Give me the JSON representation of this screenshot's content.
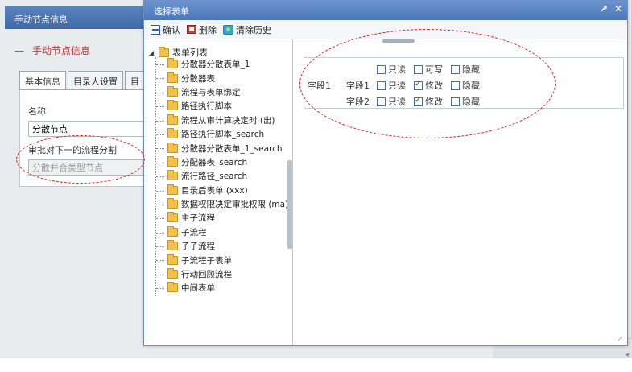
{
  "background": {
    "header_title": "手动节点信息",
    "page_title": "手动节点信息",
    "tabs": [
      "基本信息",
      "目录人设置",
      "目"
    ],
    "form": {
      "name_label": "名称",
      "name_value": "分散节点",
      "type_label": "审批对下一的流程分割",
      "type_value": "分散并合类型节点"
    }
  },
  "dialog": {
    "title": "选择表单",
    "controls": {
      "restore": "↗",
      "close": "✕"
    },
    "toolbar": {
      "confirm": "确认",
      "delete": "删除",
      "clear": "清除历史"
    },
    "tree": {
      "root": "表单列表",
      "items": [
        "分散器分散表单_1",
        "分散器表",
        "流程与表单绑定",
        "路径执行脚本",
        "流程从审计算决定时 (出)",
        "路径执行脚本_search",
        "分散器分散表单_1_search",
        "分配器表_search",
        "流行路径_search",
        "目录后表单 (xxx)",
        "数据权限决定审批权限 (ma)",
        "主子流程",
        "子流程",
        "子子流程",
        "子流程子表单",
        "行动回顾流程",
        "中间表单"
      ]
    },
    "fields": {
      "field_label": "字段1",
      "rows": [
        {
          "label": "",
          "options": [
            {
              "text": "只读",
              "checked": false
            },
            {
              "text": "可写",
              "checked": false
            },
            {
              "text": "隐藏",
              "checked": false
            }
          ]
        },
        {
          "label": "字段1",
          "options": [
            {
              "text": "只读",
              "checked": false
            },
            {
              "text": "修改",
              "checked": true
            },
            {
              "text": "隐藏",
              "checked": false
            }
          ]
        },
        {
          "label": "字段2",
          "options": [
            {
              "text": "只读",
              "checked": false
            },
            {
              "text": "修改",
              "checked": true
            },
            {
              "text": "隐藏",
              "checked": false
            }
          ]
        }
      ]
    }
  },
  "colors": {
    "annotation": "#e21b1b",
    "titlebar": "#4c77b6",
    "folder": "#f0c24a"
  }
}
